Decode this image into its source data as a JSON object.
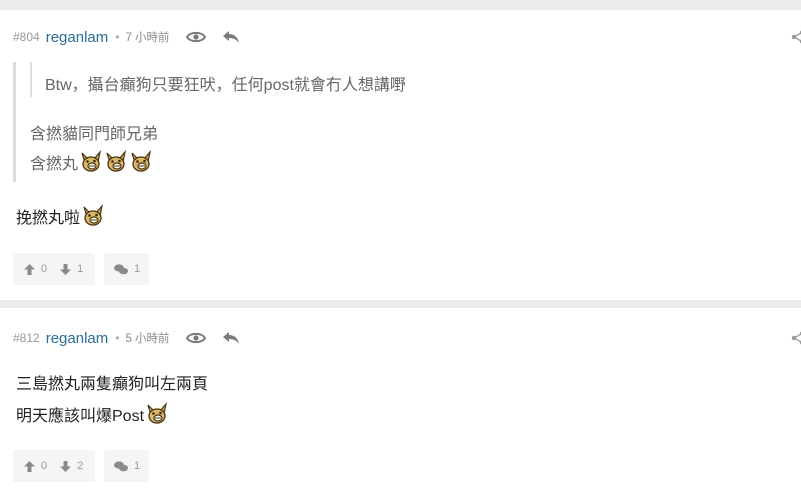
{
  "posts": [
    {
      "id": "#804",
      "author": "reganlam",
      "separator": "•",
      "time": "7 小時前",
      "quote_nested": "Btw，攝台癲狗只要狂吠，任何post就會冇人想講嘢",
      "quote_lines": [
        "含撚貓同門師兄弟",
        "含撚丸"
      ],
      "body_lines": [
        "挽撚丸啦"
      ],
      "upvotes": "0",
      "downvotes": "1",
      "replies": "1"
    },
    {
      "id": "#812",
      "author": "reganlam",
      "separator": "•",
      "time": "5 小時前",
      "body_lines": [
        "三島撚丸兩隻癲狗叫左兩頁",
        "明天應該叫爆Post"
      ],
      "upvotes": "0",
      "downvotes": "2",
      "replies": "1"
    }
  ],
  "icons": {
    "watch": "eye-icon",
    "reply": "reply-icon",
    "share": "share-icon",
    "upvote": "arrow-up-icon",
    "downvote": "arrow-down-icon",
    "comments": "comment-bubbles-icon",
    "emoji": "dog-face-emoji-icon"
  },
  "colors": {
    "author": "#2a6e9a",
    "meta": "#999999",
    "page_background": "#ececec",
    "card_background": "#ffffff"
  }
}
